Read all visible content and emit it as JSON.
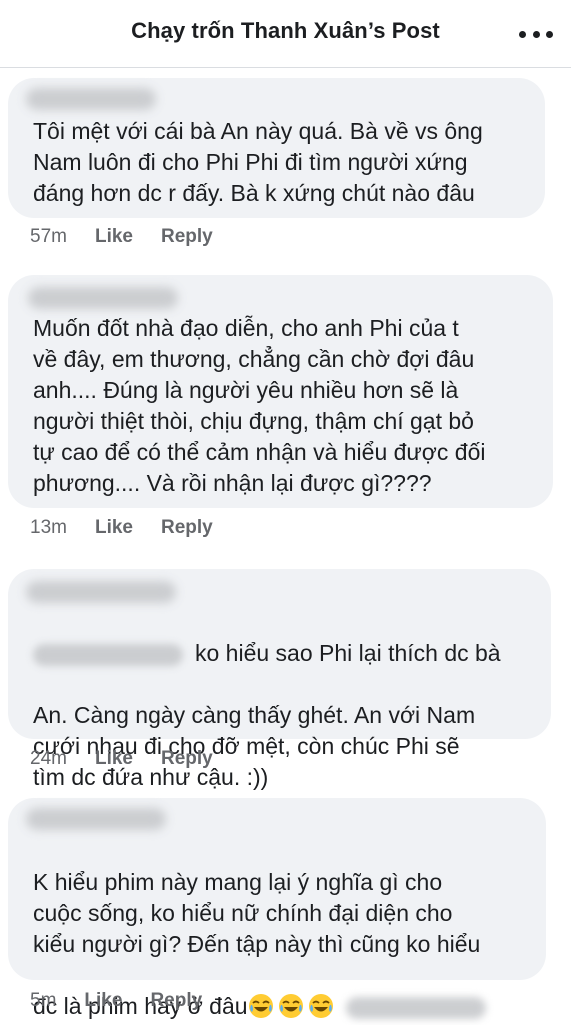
{
  "header": {
    "title": "Chạy trốn Thanh Xuân’s Post",
    "more_icon": "more-horizontal-icon"
  },
  "comments": [
    {
      "text": "Tôi mệt với cái bà An này quá. Bà về vs ông\nNam luôn đi cho Phi Phi đi tìm người xứng\nđáng hơn dc r đấy. Bà k xứng chút nào đâu",
      "time": "57m",
      "like": "Like",
      "reply": "Reply"
    },
    {
      "text": "Muốn đốt nhà đạo diễn, cho anh Phi của t\nvề đây, em thương, chẳng cần chờ đợi đâu\nanh.... Đúng là người yêu nhiều hơn sẽ là\nngười thiệt thòi, chịu đựng, thậm chí gạt bỏ\ntự cao để có thể cảm nhận và hiểu được đối\nphương.... Và rồi nhận lại được gì????",
      "time": "13m",
      "like": "Like",
      "reply": "Reply"
    },
    {
      "text_first": "ko hiểu sao Phi lại thích dc bà",
      "text_rest": "An. Càng ngày càng thấy ghét. An với Nam\ncưới nhau đi cho đỡ mệt, còn chúc Phi sẽ\ntìm dc đứa như cậu. :))",
      "time": "24m",
      "like": "Like",
      "reply": "Reply"
    },
    {
      "text": "K hiểu phim này mang lại ý nghĩa gì cho\ncuộc sống, ko hiểu nữ chính đại diện cho\nkiểu người gì? Đến tập này thì cũng ko hiểu",
      "text_last": "đc là phim hay ở đâu",
      "emoji_icon": "face-with-tears-of-joy-icon",
      "time": "5m",
      "like": "Like",
      "reply": "Reply"
    }
  ],
  "colors": {
    "bubble": "#f0f2f5",
    "text": "#1c1e21",
    "meta": "#65676b",
    "divider": "#dadde1"
  }
}
